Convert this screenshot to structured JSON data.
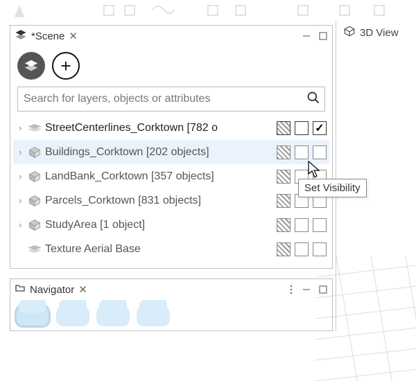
{
  "scene_panel": {
    "title": "*Scene",
    "toolbar": {
      "layers_button": "layers",
      "add_button": "+"
    },
    "search": {
      "placeholder": "Search for layers, objects or attributes"
    },
    "layers": [
      {
        "name": "StreetCenterlines_Corktown [782 o",
        "expandable": true,
        "dark": true,
        "icon": "mesh",
        "cols": [
          "hatch",
          "empty",
          "checked"
        ]
      },
      {
        "name": "Buildings_Corktown [202 objects]",
        "expandable": true,
        "dark": false,
        "icon": "cube",
        "cols": [
          "hatch",
          "empty",
          "empty"
        ],
        "selected": true
      },
      {
        "name": "LandBank_Corktown [357 objects]",
        "expandable": true,
        "dark": false,
        "icon": "cube",
        "cols": [
          "hatch",
          "empty",
          "empty"
        ]
      },
      {
        "name": "Parcels_Corktown [831 objects]",
        "expandable": true,
        "dark": false,
        "icon": "cube",
        "cols": [
          "hatch",
          "empty",
          "empty"
        ]
      },
      {
        "name": "StudyArea [1 object]",
        "expandable": true,
        "dark": false,
        "icon": "cube",
        "cols": [
          "hatch",
          "empty",
          "empty"
        ]
      },
      {
        "name": "Texture Aerial Base",
        "expandable": false,
        "dark": false,
        "icon": "mesh",
        "cols": [
          "hatch",
          "empty",
          "empty"
        ]
      }
    ]
  },
  "navigator_panel": {
    "title": "Navigator"
  },
  "right_panel": {
    "title": "3D View"
  },
  "tooltip": "Set Visibility"
}
